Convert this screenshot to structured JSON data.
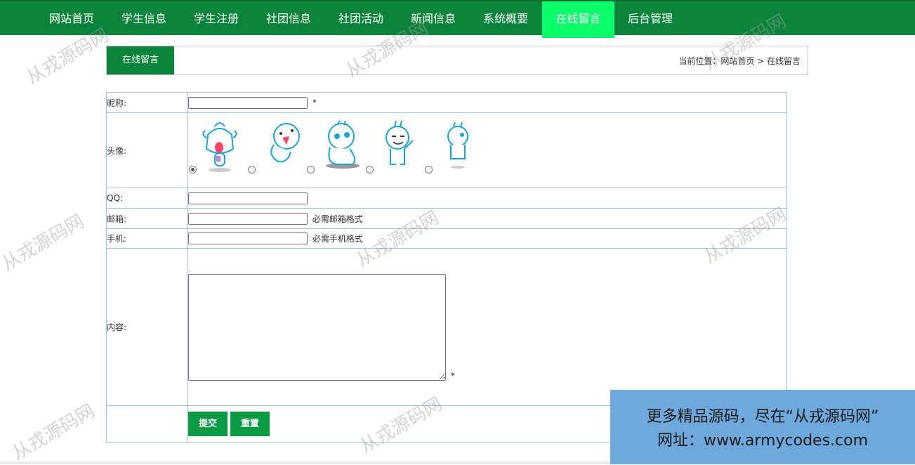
{
  "nav": {
    "items": [
      {
        "label": "网站首页"
      },
      {
        "label": "学生信息"
      },
      {
        "label": "学生注册"
      },
      {
        "label": "社团信息"
      },
      {
        "label": "社团活动"
      },
      {
        "label": "新闻信息"
      },
      {
        "label": "系统概要"
      },
      {
        "label": "在线留言",
        "active": true
      },
      {
        "label": "后台管理"
      }
    ]
  },
  "panel": {
    "tab_label": "在线留言",
    "breadcrumb": "当前位置：网站首页 > 在线留言"
  },
  "form": {
    "nickname_label": "昵称:",
    "nickname_value": "",
    "required_mark": "*",
    "avatar_label": "头像:",
    "avatars": [
      "avatar-1",
      "avatar-2",
      "avatar-3",
      "avatar-4",
      "avatar-5"
    ],
    "avatar_selected_index": 0,
    "qq_label": "QQ:",
    "qq_value": "",
    "email_label": "邮箱:",
    "email_value": "",
    "email_hint": "必需邮箱格式",
    "phone_label": "手机:",
    "phone_value": "",
    "phone_hint": "必需手机格式",
    "content_label": "内容:",
    "content_value": "",
    "content_required": "*",
    "submit_label": "提交",
    "reset_label": "重置"
  },
  "watermark": "从戎源码网",
  "promo": {
    "line1": "更多精品源码，尽在“从戎源码网”",
    "line2": "网址：www.armycodes.com"
  },
  "colors": {
    "nav_bg": "#0b843b",
    "nav_active": "#0aff6a",
    "button": "#0b9a44",
    "table_border": "#9cc3e6",
    "promo_bg": "#6fa8dc"
  }
}
